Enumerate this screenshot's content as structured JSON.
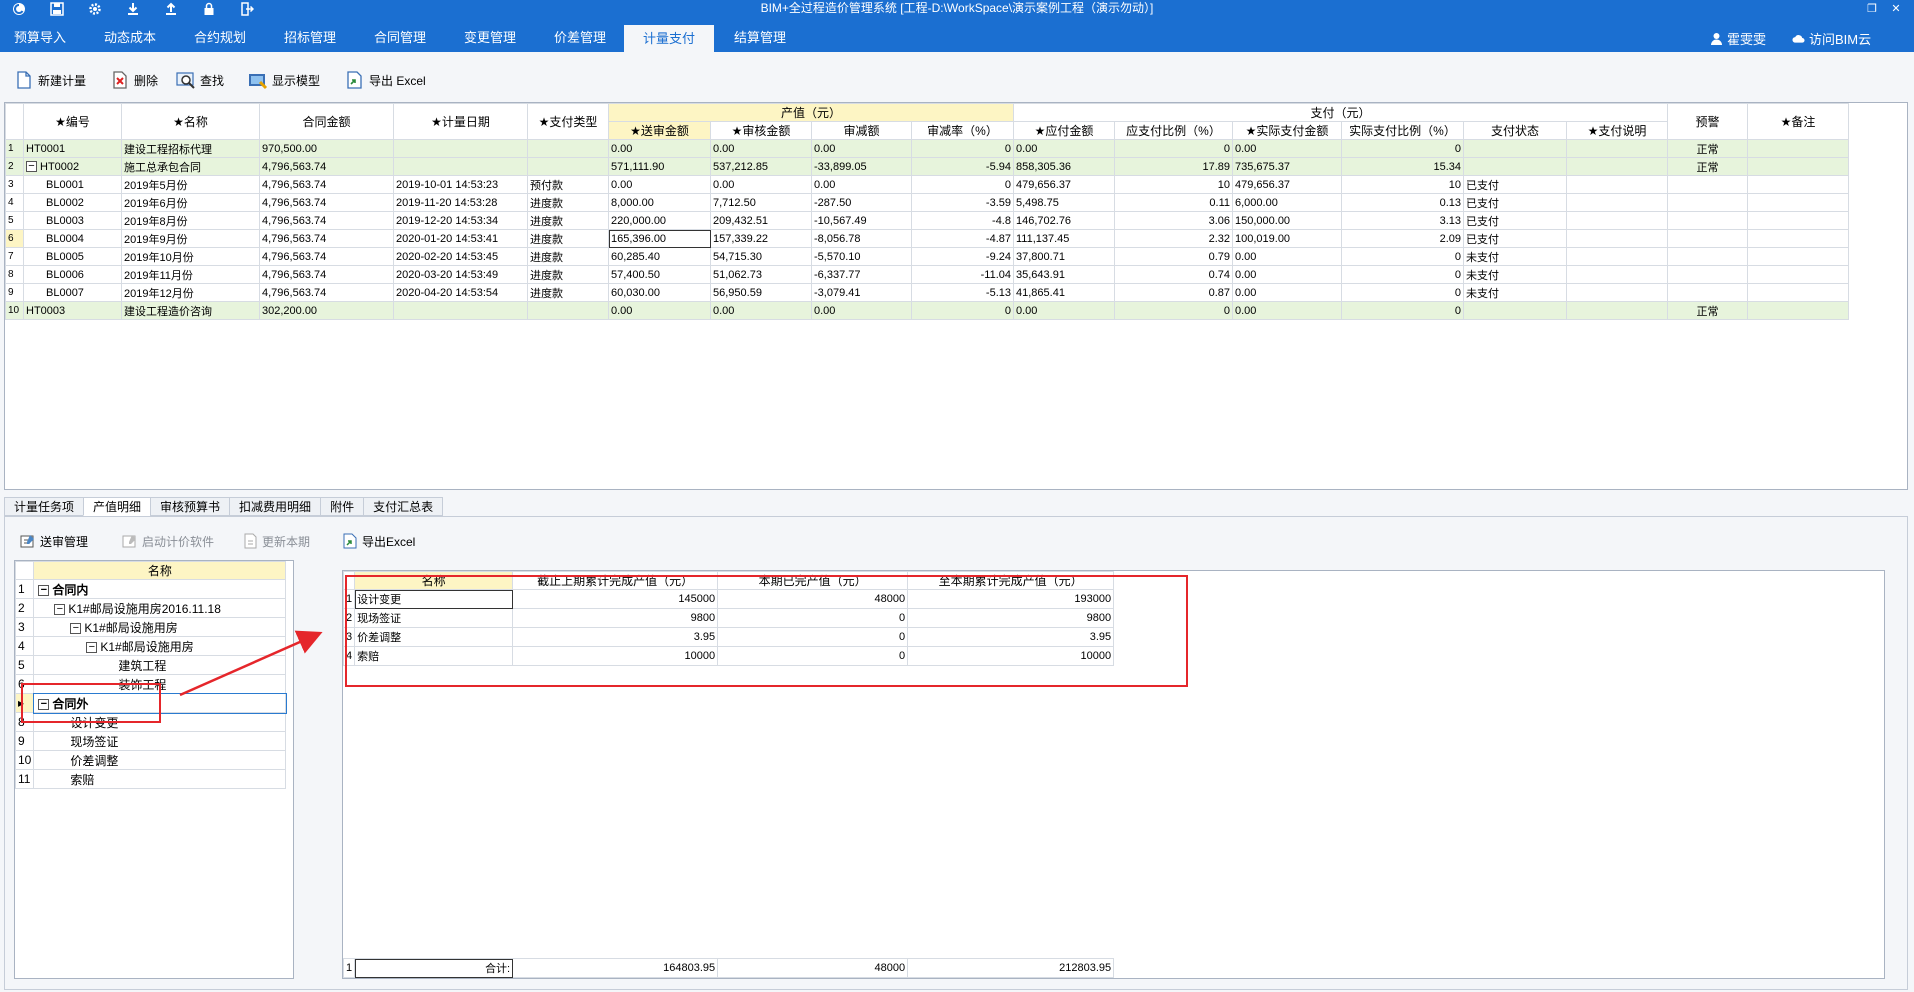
{
  "window": {
    "title": "BIM+全过程造价管理系统 [工程-D:\\WorkSpace\\演示案例工程（演示勿动）]",
    "quick_access": [
      "app-logo-icon",
      "save-icon",
      "settings-icon",
      "download-icon",
      "upload-icon",
      "lock-icon",
      "exit-icon"
    ],
    "controls": [
      "restore-icon",
      "close-icon"
    ]
  },
  "menu": {
    "items": [
      "预算导入",
      "动态成本",
      "合约规划",
      "招标管理",
      "合同管理",
      "变更管理",
      "价差管理",
      "计量支付",
      "结算管理"
    ],
    "active": "计量支付",
    "user": "霍雯雯",
    "cloud": "访问BIM云"
  },
  "toolbar": {
    "new": "新建计量",
    "delete": "删除",
    "find": "查找",
    "show_model": "显示模型",
    "export": "导出 Excel"
  },
  "main_grid": {
    "group_output": "产值（元）",
    "group_payment": "支付（元）",
    "headers": [
      "★编号",
      "★名称",
      "合同金额",
      "★计量日期",
      "★支付类型",
      "★送审金额",
      "★审核金额",
      "审减额",
      "审减率（%）",
      "★应付金额",
      "应支付比例（%）",
      "★实际支付金额",
      "实际支付比例（%）",
      "支付状态",
      "★支付说明",
      "预警",
      "★备注"
    ],
    "rows": [
      {
        "n": "1",
        "code": "HT0001",
        "name": "建设工程招标代理",
        "amount": "970,500.00",
        "date": "",
        "type": "",
        "submit": "0.00",
        "audit": "0.00",
        "cut": "0.00",
        "rate": "0",
        "payable": "0.00",
        "pratio": "0",
        "actual": "0.00",
        "aratio": "0",
        "status": "",
        "note": "",
        "warn": "正常",
        "remark": "",
        "level": 0,
        "green": true
      },
      {
        "n": "2",
        "code": "HT0002",
        "name": "施工总承包合同",
        "amount": "4,796,563.74",
        "date": "",
        "type": "",
        "submit": "571,111.90",
        "audit": "537,212.85",
        "cut": "-33,899.05",
        "rate": "-5.94",
        "payable": "858,305.36",
        "pratio": "17.89",
        "actual": "735,675.37",
        "aratio": "15.34",
        "status": "",
        "note": "",
        "warn": "正常",
        "remark": "",
        "level": 0,
        "green": true,
        "expander": "−"
      },
      {
        "n": "3",
        "code": "BL0001",
        "name": "2019年5月份",
        "amount": "4,796,563.74",
        "date": "2019-10-01 14:53:23",
        "type": "预付款",
        "submit": "0.00",
        "audit": "0.00",
        "cut": "0.00",
        "rate": "0",
        "payable": "479,656.37",
        "pratio": "10",
        "actual": "479,656.37",
        "aratio": "10",
        "status": "已支付",
        "note": "",
        "warn": "",
        "remark": "",
        "level": 1
      },
      {
        "n": "4",
        "code": "BL0002",
        "name": "2019年6月份",
        "amount": "4,796,563.74",
        "date": "2019-11-20 14:53:28",
        "type": "进度款",
        "submit": "8,000.00",
        "audit": "7,712.50",
        "cut": "-287.50",
        "rate": "-3.59",
        "payable": "5,498.75",
        "pratio": "0.11",
        "actual": "6,000.00",
        "aratio": "0.13",
        "status": "已支付",
        "note": "",
        "warn": "",
        "remark": "",
        "level": 1
      },
      {
        "n": "5",
        "code": "BL0003",
        "name": "2019年8月份",
        "amount": "4,796,563.74",
        "date": "2019-12-20 14:53:34",
        "type": "进度款",
        "submit": "220,000.00",
        "audit": "209,432.51",
        "cut": "-10,567.49",
        "rate": "-4.8",
        "payable": "146,702.76",
        "pratio": "3.06",
        "actual": "150,000.00",
        "aratio": "3.13",
        "status": "已支付",
        "note": "",
        "warn": "",
        "remark": "",
        "level": 1
      },
      {
        "n": "6",
        "code": "BL0004",
        "name": "2019年9月份",
        "amount": "4,796,563.74",
        "date": "2020-01-20 14:53:41",
        "type": "进度款",
        "submit": "165,396.00",
        "audit": "157,339.22",
        "cut": "-8,056.78",
        "rate": "-4.87",
        "payable": "111,137.45",
        "pratio": "2.32",
        "actual": "100,019.00",
        "aratio": "2.09",
        "status": "已支付",
        "note": "",
        "warn": "",
        "remark": "",
        "level": 1,
        "current": true
      },
      {
        "n": "7",
        "code": "BL0005",
        "name": "2019年10月份",
        "amount": "4,796,563.74",
        "date": "2020-02-20 14:53:45",
        "type": "进度款",
        "submit": "60,285.40",
        "audit": "54,715.30",
        "cut": "-5,570.10",
        "rate": "-9.24",
        "payable": "37,800.71",
        "pratio": "0.79",
        "actual": "0.00",
        "aratio": "0",
        "status": "未支付",
        "note": "",
        "warn": "",
        "remark": "",
        "level": 1
      },
      {
        "n": "8",
        "code": "BL0006",
        "name": "2019年11月份",
        "amount": "4,796,563.74",
        "date": "2020-03-20 14:53:49",
        "type": "进度款",
        "submit": "57,400.50",
        "audit": "51,062.73",
        "cut": "-6,337.77",
        "rate": "-11.04",
        "payable": "35,643.91",
        "pratio": "0.74",
        "actual": "0.00",
        "aratio": "0",
        "status": "未支付",
        "note": "",
        "warn": "",
        "remark": "",
        "level": 1
      },
      {
        "n": "9",
        "code": "BL0007",
        "name": "2019年12月份",
        "amount": "4,796,563.74",
        "date": "2020-04-20 14:53:54",
        "type": "进度款",
        "submit": "60,030.00",
        "audit": "56,950.59",
        "cut": "-3,079.41",
        "rate": "-5.13",
        "payable": "41,865.41",
        "pratio": "0.87",
        "actual": "0.00",
        "aratio": "0",
        "status": "未支付",
        "note": "",
        "warn": "",
        "remark": "",
        "level": 1
      },
      {
        "n": "10",
        "code": "HT0003",
        "name": "建设工程造价咨询",
        "amount": "302,200.00",
        "date": "",
        "type": "",
        "submit": "0.00",
        "audit": "0.00",
        "cut": "0.00",
        "rate": "0",
        "payable": "0.00",
        "pratio": "0",
        "actual": "0.00",
        "aratio": "0",
        "status": "",
        "note": "",
        "warn": "正常",
        "remark": "",
        "level": 0,
        "green": true
      }
    ]
  },
  "bottom_tabs": [
    "计量任务项",
    "产值明细",
    "审核预算书",
    "扣减费用明细",
    "附件",
    "支付汇总表"
  ],
  "bottom_active": "产值明细",
  "sub_toolbar": {
    "review": "送审管理",
    "launch": "启动计价软件",
    "update": "更新本期",
    "export": "导出Excel"
  },
  "tree": {
    "header": "名称",
    "rows": [
      {
        "n": "1",
        "label": "合同内",
        "level": 0,
        "bold": true,
        "expander": "−"
      },
      {
        "n": "2",
        "label": "K1#邮局设施用房2016.11.18",
        "level": 1,
        "expander": "−"
      },
      {
        "n": "3",
        "label": "K1#邮局设施用房",
        "level": 2,
        "expander": "−"
      },
      {
        "n": "4",
        "label": "K1#邮局设施用房",
        "level": 3,
        "expander": "−"
      },
      {
        "n": "5",
        "label": "建筑工程",
        "level": 4
      },
      {
        "n": "6",
        "label": "装饰工程",
        "level": 4
      },
      {
        "n": "▸",
        "label": "合同外",
        "level": 0,
        "bold": true,
        "expander": "−",
        "selected": true
      },
      {
        "n": "8",
        "label": "设计变更",
        "level": 1
      },
      {
        "n": "9",
        "label": "现场签证",
        "level": 1
      },
      {
        "n": "10",
        "label": "价差调整",
        "level": 1
      },
      {
        "n": "11",
        "label": "索赔",
        "level": 1
      }
    ]
  },
  "detail": {
    "headers": [
      "名称",
      "截止上期累计完成产值（元）",
      "本期已完产值（元）",
      "至本期累计完成产值（元）"
    ],
    "rows": [
      {
        "n": "1",
        "name": "设计变更",
        "prev": "145000",
        "cur": "48000",
        "total": "193000"
      },
      {
        "n": "2",
        "name": "现场签证",
        "prev": "9800",
        "cur": "0",
        "total": "9800"
      },
      {
        "n": "3",
        "name": "价差调整",
        "prev": "3.95",
        "cur": "0",
        "total": "3.95"
      },
      {
        "n": "4",
        "name": "索赔",
        "prev": "10000",
        "cur": "0",
        "total": "10000"
      }
    ],
    "footer": {
      "n": "1",
      "label": "合计:",
      "prev": "164803.95",
      "cur": "48000",
      "total": "212803.95"
    }
  },
  "annotation_color": "#e5262b"
}
